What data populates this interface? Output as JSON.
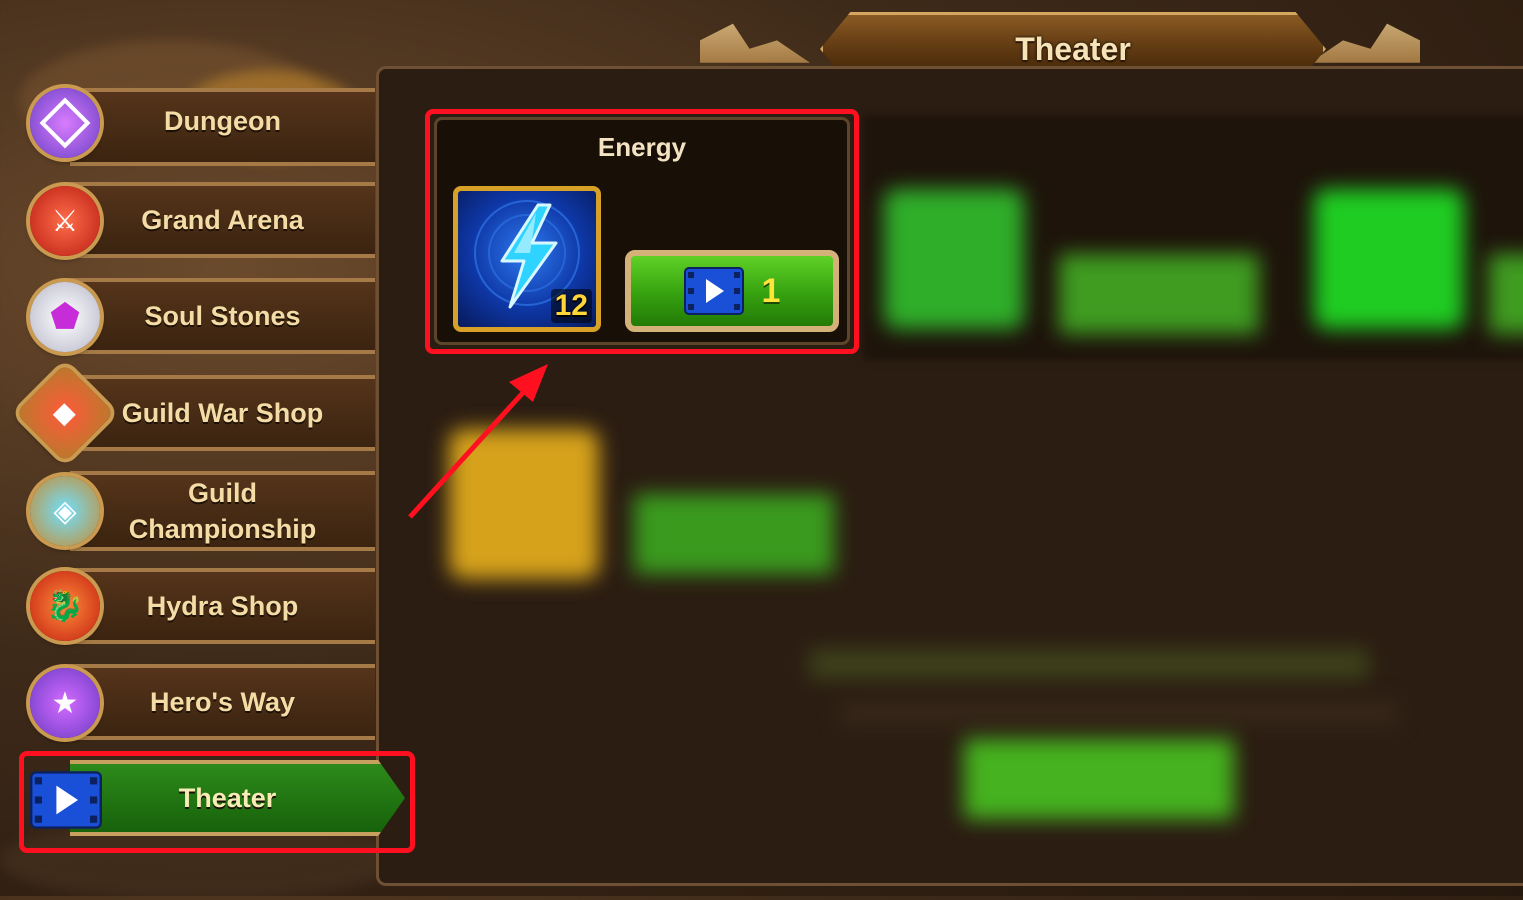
{
  "screen_title": "Theater",
  "menu": {
    "items": [
      {
        "label": "Dungeon",
        "icon": "dungeon-icon"
      },
      {
        "label": "Grand Arena",
        "icon": "grand-arena-icon"
      },
      {
        "label": "Soul Stones",
        "icon": "soul-stone-icon"
      },
      {
        "label": "Guild War Shop",
        "icon": "guild-war-icon"
      },
      {
        "label": "Guild\nChampionship",
        "label_line1": "Guild",
        "label_line2": "Championship",
        "icon": "guild-championship-icon"
      },
      {
        "label": "Hydra Shop",
        "icon": "hydra-icon"
      },
      {
        "label": "Hero's Way",
        "icon": "heros-way-icon"
      },
      {
        "label": "Theater",
        "icon": "video-play-icon",
        "active": true
      }
    ]
  },
  "energy_card": {
    "title": "Energy",
    "quantity": "12",
    "reward_icon": "energy-lightning-icon",
    "watch_button": {
      "icon": "video-play-icon",
      "cost": "1"
    }
  },
  "colors": {
    "highlight": "#ff1020",
    "active_tab": "#2d8a1a",
    "button_green": "#35a10f",
    "gold_text": "#ffd63a"
  }
}
